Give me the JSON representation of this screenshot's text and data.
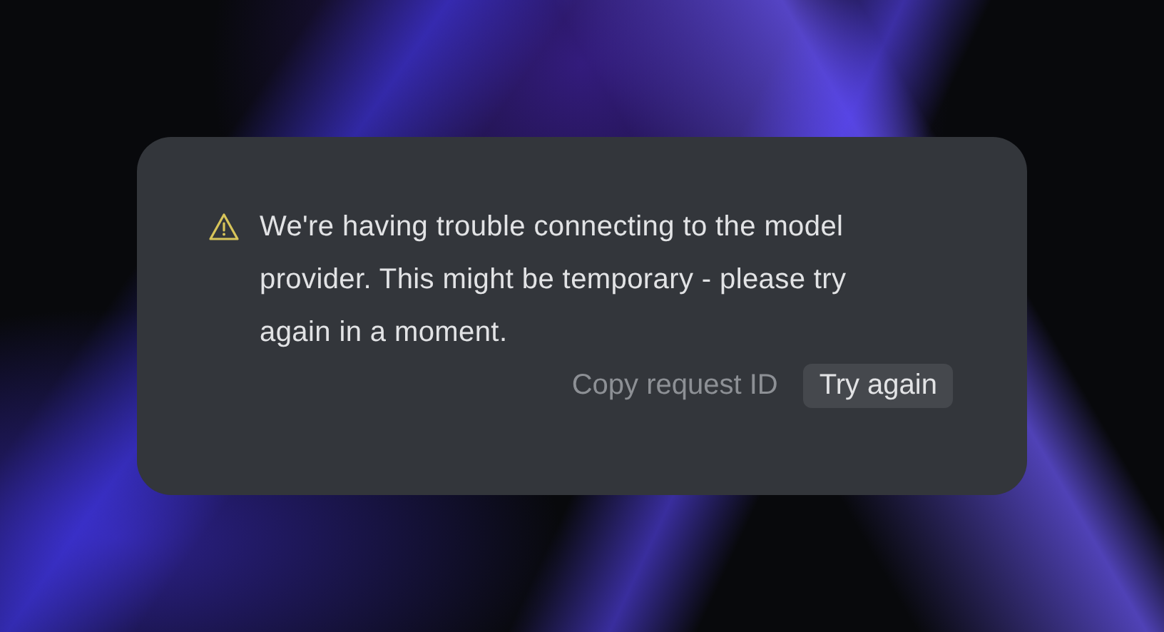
{
  "alert": {
    "message": "We're having trouble connecting to the model provider. This might be temporary - please try again in a moment.",
    "actions": [
      {
        "label": "Copy request ID",
        "kind": "link"
      },
      {
        "label": "Try again",
        "kind": "button"
      }
    ]
  }
}
